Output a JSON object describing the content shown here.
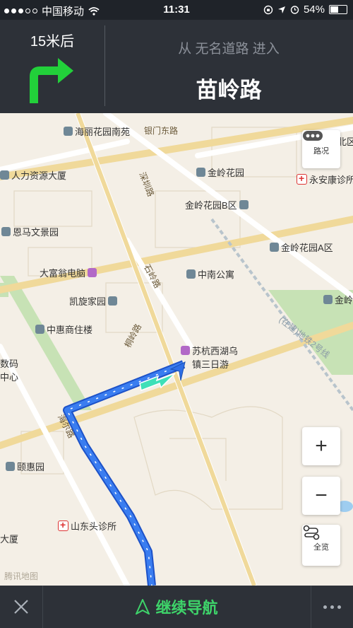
{
  "status": {
    "carrier": "中国移动",
    "time": "11:31",
    "battery": "54%",
    "battery_level": 0.54
  },
  "nav": {
    "distance": "15米后",
    "turn_direction": "right",
    "from_text": "从 无名道路 进入",
    "next_road": "苗岭路"
  },
  "map": {
    "pois": [
      {
        "name": "海丽花园南苑",
        "icon": "building-icon"
      },
      {
        "name": "银门东路",
        "icon": "road-label"
      },
      {
        "name": "路况",
        "icon": "traffic-icon"
      },
      {
        "name": "人力资源大厦",
        "icon": "building-icon"
      },
      {
        "name": "金岭花园",
        "icon": "building-icon"
      },
      {
        "name": "永安康诊所",
        "icon": "clinic-icon"
      },
      {
        "name": "金岭花园B区",
        "icon": "building-icon"
      },
      {
        "name": "恩马文景园",
        "icon": "building-icon"
      },
      {
        "name": "金岭花园A区",
        "icon": "building-icon"
      },
      {
        "name": "大富翁电脑",
        "icon": "shop-icon"
      },
      {
        "name": "中南公寓",
        "icon": "building-icon"
      },
      {
        "name": "凯旋家园",
        "icon": "building-icon"
      },
      {
        "name": "金岭",
        "icon": "building-icon"
      },
      {
        "name": "中惠商住楼",
        "icon": "building-icon"
      },
      {
        "name": "苏杭西湖乌",
        "icon": "shop-icon"
      },
      {
        "name": "镇三日游",
        "icon": ""
      },
      {
        "name": "颐惠园",
        "icon": "building-icon"
      },
      {
        "name": "山东头诊所",
        "icon": "clinic-icon"
      },
      {
        "name": "大厦",
        "icon": ""
      },
      {
        "name": "数码",
        "icon": ""
      },
      {
        "name": "中心",
        "icon": ""
      },
      {
        "name": "北区",
        "icon": ""
      }
    ],
    "roads": [
      "深圳路",
      "石岭路",
      "桐岭路",
      "海尔路",
      "(在建)地铁2号线",
      "苗岭路"
    ],
    "traffic_label": "路况",
    "zoom_in": "+",
    "zoom_out": "−",
    "overview_label": "全览",
    "watermark": "腾讯地图"
  },
  "bottom": {
    "continue_label": "继续导航"
  },
  "colors": {
    "route": "#2f6fe6",
    "turn_arrow": "#22d03a",
    "continue": "#3ed46a",
    "panel": "#2d3138"
  }
}
